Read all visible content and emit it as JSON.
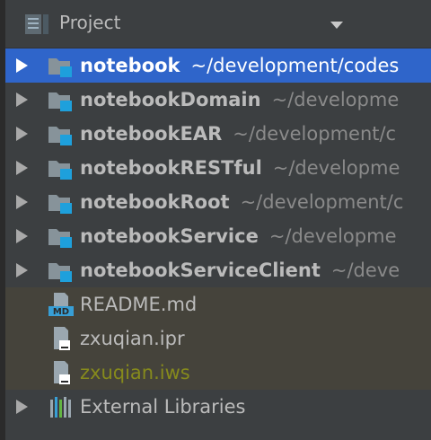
{
  "header": {
    "title": "Project",
    "icon": "project-view-icon"
  },
  "colors": {
    "panel_bg": "#3c3f41",
    "selection": "#2f65ca",
    "untracked_bg": "#45433b",
    "module_icon_accent": "#1ea0dc",
    "workspace_file_text": "#868a1c"
  },
  "modules": [
    {
      "name": "notebook",
      "path": "~/development/codes",
      "selected": true
    },
    {
      "name": "notebookDomain",
      "path": "~/developme"
    },
    {
      "name": "notebookEAR",
      "path": "~/development/c"
    },
    {
      "name": "notebookRESTful",
      "path": "~/developme"
    },
    {
      "name": "notebookRoot",
      "path": "~/development/c"
    },
    {
      "name": "notebookService",
      "path": "~/developme"
    },
    {
      "name": "notebookServiceClient",
      "path": "~/deve"
    }
  ],
  "files": [
    {
      "name": "README.md",
      "icon": "markdown-file-icon",
      "icon_text": "MD"
    },
    {
      "name": "zxuqian.ipr",
      "icon": "project-file-icon"
    },
    {
      "name": "zxuqian.iws",
      "icon": "workspace-file-icon"
    }
  ],
  "external_libraries": {
    "label": "External Libraries",
    "icon": "libraries-icon"
  }
}
